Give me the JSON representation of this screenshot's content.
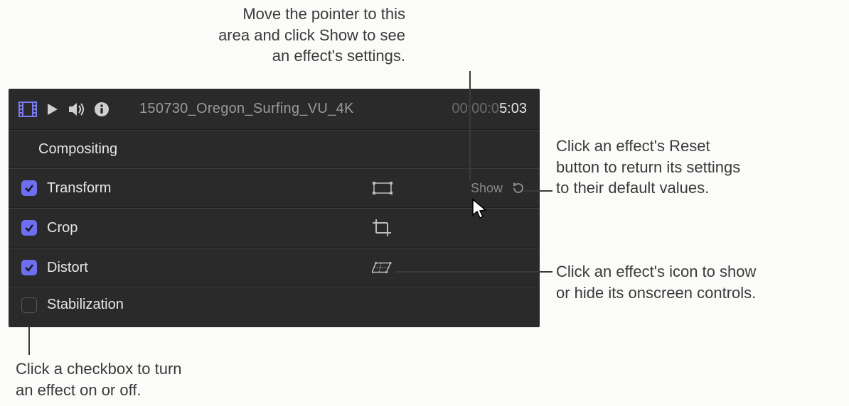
{
  "annotations": {
    "top": "Move the pointer to this\narea and click Show to see\nan effect's settings.",
    "reset": "Click an effect's Reset\nbutton to return its settings\nto their default values.",
    "icon": "Click an effect's icon to show\nor hide its onscreen controls.",
    "checkbox": "Click a checkbox to turn\nan effect on or off."
  },
  "header": {
    "clip_name": "150730_Oregon_Surfing_VU_4K",
    "timecode_dim": "00:00:0",
    "timecode_bright": "5:03"
  },
  "section": {
    "label": "Compositing"
  },
  "effects": [
    {
      "label": "Transform",
      "checked": true,
      "icon": "transform-rect-icon",
      "show": "Show",
      "has_reset": true
    },
    {
      "label": "Crop",
      "checked": true,
      "icon": "crop-icon"
    },
    {
      "label": "Distort",
      "checked": true,
      "icon": "distort-icon"
    },
    {
      "label": "Stabilization",
      "checked": false
    }
  ],
  "icons": {
    "film": "film-icon",
    "play": "play-icon",
    "speaker": "speaker-icon",
    "info": "info-icon"
  }
}
